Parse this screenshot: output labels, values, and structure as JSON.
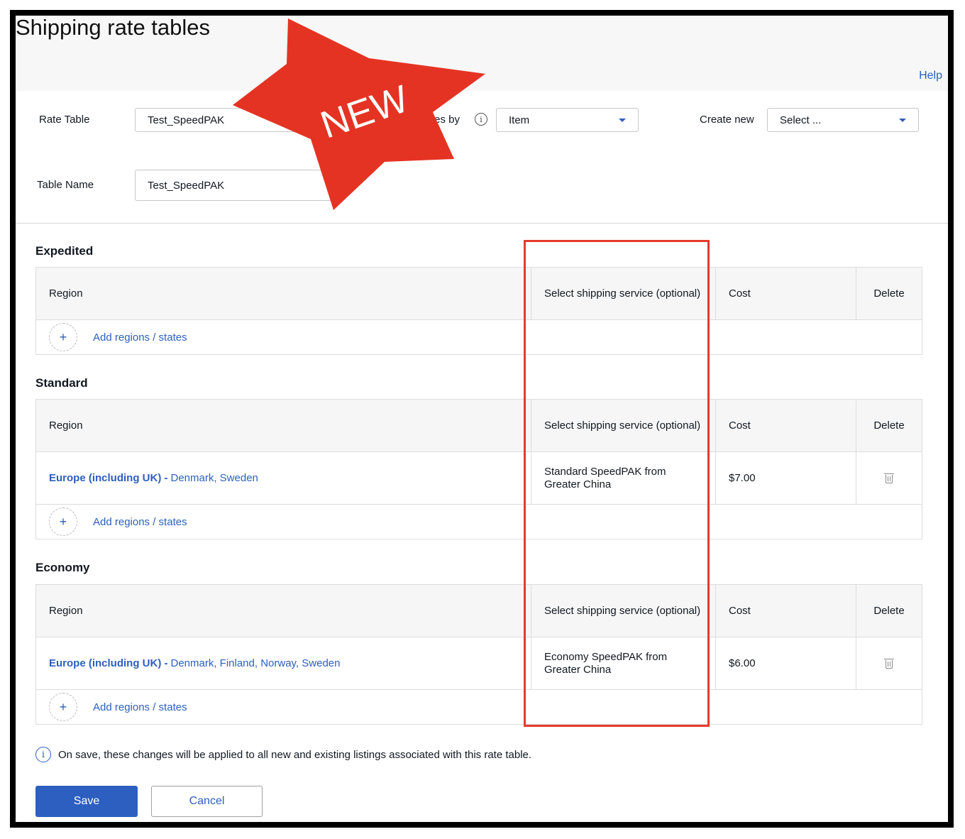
{
  "page": {
    "title": "Shipping rate tables",
    "help_label": "Help"
  },
  "badge": {
    "text": "NEW",
    "color": "#e53323"
  },
  "form": {
    "rate_table_label": "Rate Table",
    "rate_table_value": "Test_SpeedPAK",
    "rates_by_label": "tes by",
    "rates_by_value": "Item",
    "create_new_label": "Create new",
    "create_new_value": "Select ...",
    "table_name_label": "Table Name",
    "table_name_value": "Test_SpeedPAK"
  },
  "columns": {
    "region": "Region",
    "service": "Select shipping service (optional)",
    "cost": "Cost",
    "delete": "Delete"
  },
  "add_label": "Add regions / states",
  "sections": [
    {
      "title": "Expedited",
      "rows": []
    },
    {
      "title": "Standard",
      "rows": [
        {
          "region_group": "Europe (including UK) -",
          "countries": "Denmark, Sweden",
          "service": "Standard SpeedPAK from Greater China",
          "cost": "$7.00"
        }
      ]
    },
    {
      "title": "Economy",
      "rows": [
        {
          "region_group": "Europe (including UK) -",
          "countries": "Denmark, Finland, Norway, Sweden",
          "service": "Economy SpeedPAK from Greater China",
          "cost": "$6.00"
        }
      ]
    }
  ],
  "note": "On save, these changes will be applied to all new and existing listings associated with this rate table.",
  "buttons": {
    "save": "Save",
    "cancel": "Cancel"
  },
  "colors": {
    "link": "#2c5fbf",
    "highlight": "#e53b2c"
  }
}
